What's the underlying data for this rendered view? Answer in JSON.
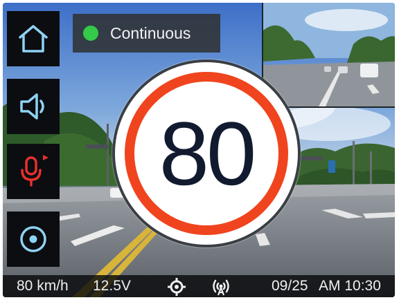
{
  "screen": {
    "type": "dashcam-live-view"
  },
  "sidebar": {
    "buttons": [
      {
        "name": "home",
        "icon": "home-icon",
        "color": "#8fd3f4"
      },
      {
        "name": "volume",
        "icon": "speaker-icon",
        "color": "#8fd3f4"
      },
      {
        "name": "voice-recording",
        "icon": "microphone-icon",
        "color": "#e8302c",
        "indicator_color": "#e8302c"
      },
      {
        "name": "record",
        "icon": "record-target-icon",
        "color": "#8fd3f4"
      }
    ]
  },
  "mode_badge": {
    "dot_color": "#35c94a",
    "label": "Continuous"
  },
  "speed_limit": {
    "value": "80",
    "ring_color": "#f0441e"
  },
  "status_bar": {
    "speed": "80 km/h",
    "voltage": "12.5V",
    "gps_icon": "gps-icon",
    "wifi_icon": "wireless-icon",
    "date": "09/25",
    "time": "AM 10:30"
  }
}
